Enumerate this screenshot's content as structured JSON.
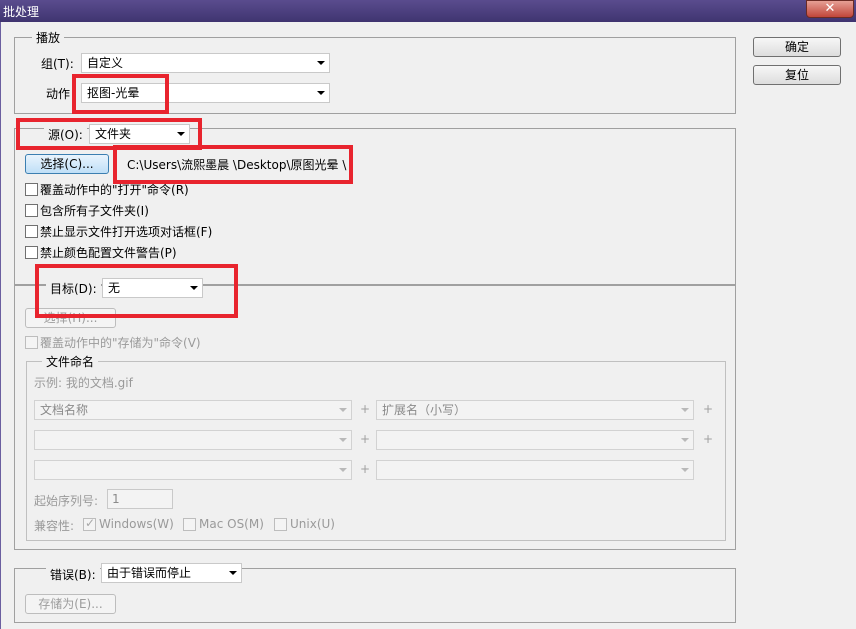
{
  "window": {
    "title": "批处理",
    "close_glyph": "✕"
  },
  "buttons": {
    "ok": "确定",
    "reset": "复位"
  },
  "play": {
    "legend": "播放",
    "set_label": "组(T):",
    "set_value": "自定义",
    "action_label": "动作",
    "action_value": "抠图-光晕"
  },
  "source": {
    "label": "源(O):",
    "value": "文件夹",
    "choose_button": "选择(C)...",
    "path": "C:\\Users\\流熙墨晨 \\Desktop\\原图光晕 \\",
    "checkboxes": [
      {
        "label": "覆盖动作中的\"打开\"命令(R)",
        "checked": false
      },
      {
        "label": "包含所有子文件夹(I)",
        "checked": false
      },
      {
        "label": "禁止显示文件打开选项对话框(F)",
        "checked": false
      },
      {
        "label": "禁止颜色配置文件警告(P)",
        "checked": false
      }
    ]
  },
  "destination": {
    "label": "目标(D):",
    "value": "无",
    "choose_button": "选择(H)...",
    "override_save": "覆盖动作中的\"存储为\"命令(V)",
    "naming": {
      "legend": "文件命名",
      "example": "示例: 我的文档.gif",
      "fields": [
        "文档名称",
        "扩展名（小写）",
        "",
        "",
        "",
        ""
      ],
      "plus": "+",
      "start_serial_label": "起始序列号:",
      "start_serial_value": "1",
      "compat_label": "兼容性:",
      "compat_windows": "Windows(W)",
      "compat_mac": "Mac OS(M)",
      "compat_unix": "Unix(U)",
      "compat_windows_checked": true
    }
  },
  "errors": {
    "label": "错误(B):",
    "value": "由于错误而停止",
    "save_as_button": "存储为(E)..."
  },
  "colors": {
    "highlight": "#e8242e",
    "title_bar": "#4a3e7e"
  }
}
